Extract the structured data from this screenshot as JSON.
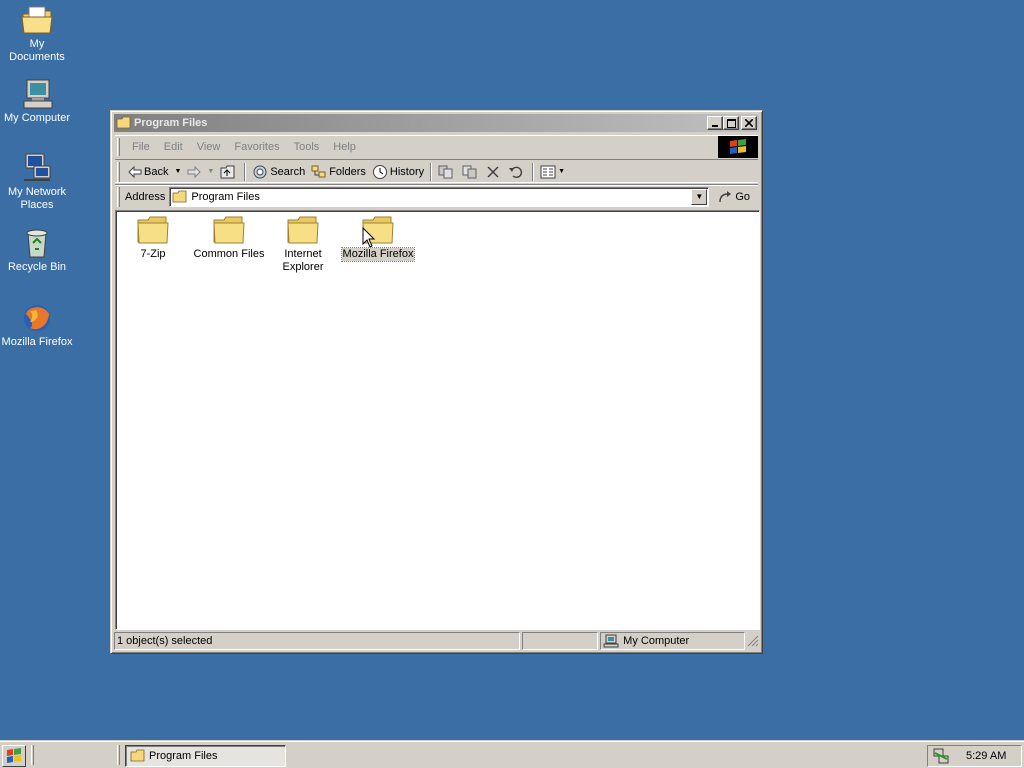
{
  "desktop": {
    "icons": [
      {
        "label": "My Documents",
        "icon": "my-documents-icon"
      },
      {
        "label": "My Computer",
        "icon": "my-computer-icon"
      },
      {
        "label": "My Network Places",
        "icon": "network-places-icon"
      },
      {
        "label": "Recycle Bin",
        "icon": "recycle-bin-icon"
      },
      {
        "label": "Mozilla Firefox",
        "icon": "firefox-icon"
      }
    ]
  },
  "window": {
    "title": "Program Files",
    "menu": [
      "File",
      "Edit",
      "View",
      "Favorites",
      "Tools",
      "Help"
    ],
    "toolbar": {
      "back": "Back",
      "search": "Search",
      "folders": "Folders",
      "history": "History"
    },
    "address": {
      "label": "Address",
      "value": "Program Files",
      "go": "Go"
    },
    "files": [
      {
        "label": "7-Zip",
        "selected": false
      },
      {
        "label": "Common Files",
        "selected": false
      },
      {
        "label": "Internet Explorer",
        "selected": false
      },
      {
        "label": "Mozilla Firefox",
        "selected": true
      }
    ],
    "status": {
      "selection": "1 object(s) selected",
      "zone": "My Computer"
    }
  },
  "taskbar": {
    "task_label": "Program Files",
    "clock": "5:29 AM"
  },
  "colors": {
    "desktop": "#3a6ea5",
    "face": "#d4d0c8",
    "folder": "#f5d97c"
  }
}
